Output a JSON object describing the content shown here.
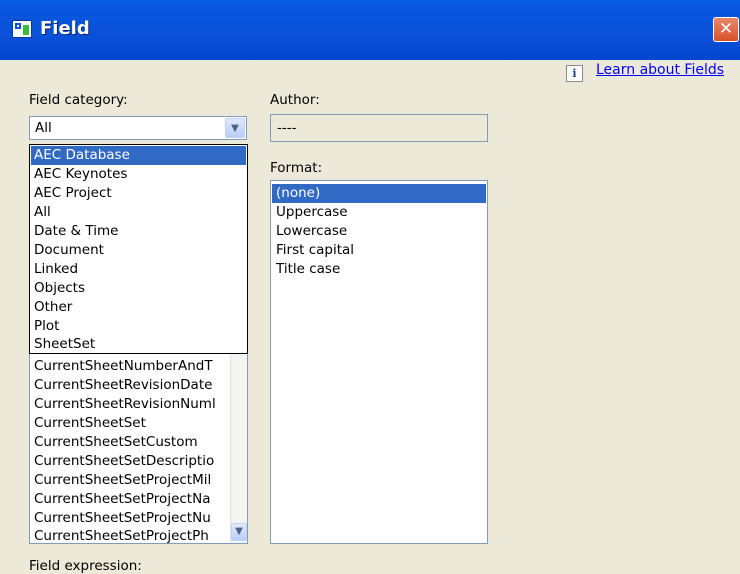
{
  "window": {
    "title": "Field",
    "close_glyph": "✕"
  },
  "learn_link": {
    "icon_glyph": "i",
    "label": "Learn about Fields"
  },
  "labels": {
    "field_category": "Field category:",
    "author": "Author:",
    "format": "Format:",
    "field_expression": "Field expression:"
  },
  "category_combo": {
    "value": "All",
    "arrow_glyph": "▼"
  },
  "author_value": "----",
  "category_dropdown": {
    "selected": "AEC Database",
    "items": [
      "AEC Database",
      "AEC Keynotes",
      "AEC Project",
      "All",
      "Date & Time",
      "Document",
      "Linked",
      "Objects",
      "Other",
      "Plot",
      "SheetSet"
    ]
  },
  "field_names": {
    "items": [
      "CurrentSheetNumberAndT",
      "CurrentSheetRevisionDate",
      "CurrentSheetRevisionNuml",
      "CurrentSheetSet",
      "CurrentSheetSetCustom",
      "CurrentSheetSetDescriptio",
      "CurrentSheetSetProjectMil",
      "CurrentSheetSetProjectNa",
      "CurrentSheetSetProjectNu",
      "CurrentSheetSetProjectPh"
    ],
    "scroll_glyph": "▼"
  },
  "format_list": {
    "selected": "(none)",
    "items": [
      "(none)",
      "Uppercase",
      "Lowercase",
      "First capital",
      "Title case"
    ]
  }
}
